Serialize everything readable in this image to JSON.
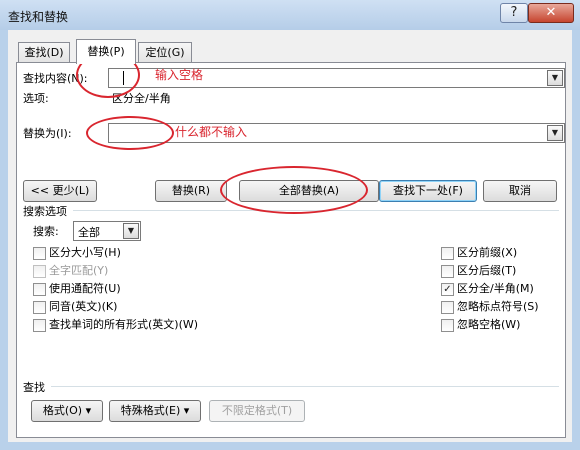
{
  "window": {
    "title": "查找和替换",
    "help_glyph": "?",
    "close_glyph": "✕"
  },
  "tabs": [
    {
      "label": "查找(D)",
      "active": false
    },
    {
      "label": "替换(P)",
      "active": true
    },
    {
      "label": "定位(G)",
      "active": false
    }
  ],
  "find": {
    "label": "查找内容(N):",
    "value": ""
  },
  "options_row": {
    "label": "选项:",
    "value": "区分全/半角"
  },
  "replace": {
    "label": "替换为(I):",
    "value": ""
  },
  "buttons": {
    "less": "<< 更少(L)",
    "replace": "替换(R)",
    "replace_all": "全部替换(A)",
    "find_next": "查找下一处(F)",
    "cancel": "取消"
  },
  "search_options": {
    "heading": "搜索选项",
    "search_label": "搜索:",
    "search_value": "全部",
    "left": [
      {
        "label": "区分大小写(H)",
        "checked": false,
        "disabled": false
      },
      {
        "label": "全字匹配(Y)",
        "checked": false,
        "disabled": true
      },
      {
        "label": "使用通配符(U)",
        "checked": false,
        "disabled": false
      },
      {
        "label": "同音(英文)(K)",
        "checked": false,
        "disabled": false
      },
      {
        "label": "查找单词的所有形式(英文)(W)",
        "checked": false,
        "disabled": false
      }
    ],
    "right": [
      {
        "label": "区分前缀(X)",
        "checked": false,
        "disabled": false
      },
      {
        "label": "区分后缀(T)",
        "checked": false,
        "disabled": false
      },
      {
        "label": "区分全/半角(M)",
        "checked": true,
        "disabled": false
      },
      {
        "label": "忽略标点符号(S)",
        "checked": false,
        "disabled": false
      },
      {
        "label": "忽略空格(W)",
        "checked": false,
        "disabled": false
      }
    ]
  },
  "find_section": {
    "heading": "查找",
    "format_button": "格式(O)",
    "special_button": "特殊格式(E)",
    "no_format_button": "不限定格式(T)"
  },
  "annotations": {
    "find_note": "输入空格",
    "replace_note": "什么都不输入"
  },
  "glyphs": {
    "dropdown": "▼",
    "check": "✓",
    "menu_arrow": "▾"
  },
  "colors": {
    "annotation": "#d9262f",
    "title_bar": "#b9d1ea",
    "dialog_bg": "#f0f0f0"
  }
}
